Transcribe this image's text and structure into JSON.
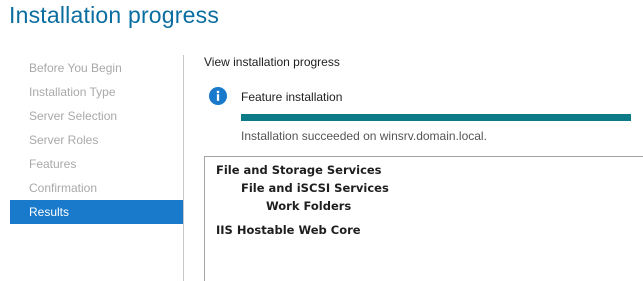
{
  "header": {
    "title": "Installation progress"
  },
  "sidebar": {
    "steps": [
      {
        "label": "Before You Begin",
        "active": false
      },
      {
        "label": "Installation Type",
        "active": false
      },
      {
        "label": "Server Selection",
        "active": false
      },
      {
        "label": "Server Roles",
        "active": false
      },
      {
        "label": "Features",
        "active": false
      },
      {
        "label": "Confirmation",
        "active": false
      },
      {
        "label": "Results",
        "active": true
      }
    ]
  },
  "main": {
    "section_label": "View installation progress",
    "feature": {
      "icon": "info-icon",
      "title": "Feature installation",
      "progress": 1.0,
      "status": "Installation succeeded on winsrv.domain.local."
    },
    "results": [
      {
        "label": "File and Storage Services",
        "level": 0
      },
      {
        "label": "File and iSCSI Services",
        "level": 1
      },
      {
        "label": "Work Folders",
        "level": 2
      },
      {
        "label": "IIS Hostable Web Core",
        "level": 0
      }
    ]
  },
  "colors": {
    "title": "#0a6ea0",
    "active_step": "#1979ca",
    "progress": "#0d7a88",
    "info_icon": "#1979ca"
  }
}
